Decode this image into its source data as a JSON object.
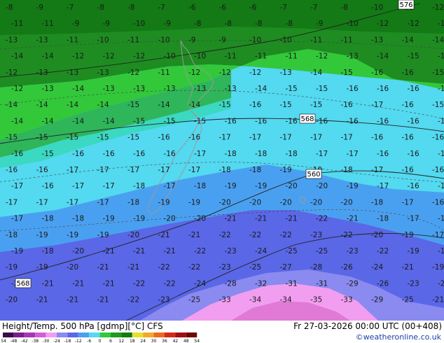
{
  "title": "Height/Temp. 500 hPa [gdmp][°C] CFS",
  "datetime": "Fr 27-03-2026 00:00 UTC (00+408)",
  "credit": "©weatheronline.co.uk",
  "height_contour_labels": [
    "576",
    "568",
    "560",
    "568"
  ],
  "colorbar": {
    "labels": [
      "-54",
      "-48",
      "-42",
      "-38",
      "-30",
      "-24",
      "-18",
      "-12",
      "-6",
      "0",
      "6",
      "12",
      "18",
      "24",
      "30",
      "36",
      "42",
      "48",
      "54"
    ],
    "colors": [
      "#3a0a4a",
      "#7a1f8a",
      "#a637b3",
      "#d05fd6",
      "#f29ef0",
      "#8a8af0",
      "#5a67e6",
      "#4aa0f0",
      "#53d9f0",
      "#32c83a",
      "#1e9a21",
      "#137a15",
      "#e8e02a",
      "#f0a82a",
      "#ec6a1c",
      "#d42a1a",
      "#a01010",
      "#6a0808"
    ]
  },
  "temperature_values": [
    [
      "-8",
      "-9",
      "-7",
      "-8",
      "-8",
      "-7",
      "-6",
      "-6",
      "-6",
      "-7",
      "-7",
      "-8",
      "-10",
      "-12",
      "-12"
    ],
    [
      "-11",
      "-11",
      "-9",
      "-9",
      "-10",
      "-9",
      "-8",
      "-8",
      "-8",
      "-8",
      "-9",
      "-10",
      "-12",
      "-12",
      "-13"
    ],
    [
      "-13",
      "-13",
      "-11",
      "-10",
      "-11",
      "-10",
      "-9",
      "-9",
      "-10",
      "-10",
      "-11",
      "-11",
      "-13",
      "-14",
      "-14"
    ],
    [
      "-14",
      "-14",
      "-12",
      "-12",
      "-12",
      "-10",
      "-10",
      "-11",
      "-11",
      "-11",
      "-12",
      "-13",
      "-14",
      "-15",
      "-16"
    ],
    [
      "-12",
      "-13",
      "-13",
      "-13",
      "-12",
      "-11",
      "-12",
      "-12",
      "-12",
      "-13",
      "-14",
      "-15",
      "-16",
      "-16",
      "-15"
    ],
    [
      "-12",
      "-13",
      "-14",
      "-13",
      "-13",
      "-13",
      "-13",
      "-13",
      "-14",
      "-15",
      "-15",
      "-16",
      "-16",
      "-16",
      "-16"
    ],
    [
      "-14",
      "-14",
      "-14",
      "-14",
      "-15",
      "-14",
      "-14",
      "-15",
      "-16",
      "-15",
      "-15",
      "-16",
      "-17",
      "-16",
      "-15"
    ],
    [
      "-14",
      "-14",
      "-14",
      "-14",
      "-15",
      "-15",
      "-15",
      "-16",
      "-16",
      "-16",
      "-16",
      "-16",
      "-16",
      "-16",
      "-16"
    ],
    [
      "-15",
      "-15",
      "-15",
      "-15",
      "-15",
      "-16",
      "-16",
      "-17",
      "-17",
      "-17",
      "-17",
      "-17",
      "-16",
      "-16",
      "-16"
    ],
    [
      "-16",
      "-15",
      "-16",
      "-16",
      "-16",
      "-16",
      "-17",
      "-18",
      "-18",
      "-18",
      "-17",
      "-17",
      "-16",
      "-16",
      "-17"
    ],
    [
      "-16",
      "-16",
      "-17",
      "-17",
      "-17",
      "-17",
      "-17",
      "-18",
      "-18",
      "-19",
      "-19",
      "-18",
      "-17",
      "-16",
      "-16"
    ],
    [
      "-17",
      "-16",
      "-17",
      "-17",
      "-18",
      "-17",
      "-18",
      "-19",
      "-19",
      "-20",
      "-20",
      "-19",
      "-17",
      "-16",
      "-15"
    ],
    [
      "-17",
      "-17",
      "-17",
      "-17",
      "-18",
      "-19",
      "-19",
      "-20",
      "-20",
      "-20",
      "-20",
      "-20",
      "-18",
      "-17",
      "-16"
    ],
    [
      "-17",
      "-18",
      "-18",
      "-19",
      "-19",
      "-20",
      "-20",
      "-21",
      "-21",
      "-21",
      "-22",
      "-21",
      "-18",
      "-17",
      "-16"
    ],
    [
      "-18",
      "-19",
      "-19",
      "-19",
      "-20",
      "-21",
      "-21",
      "-22",
      "-22",
      "-22",
      "-23",
      "-22",
      "-20",
      "-19",
      "-17"
    ],
    [
      "-19",
      "-18",
      "-20",
      "-21",
      "-21",
      "-21",
      "-22",
      "-23",
      "-24",
      "-25",
      "-25",
      "-23",
      "-22",
      "-19",
      "-18"
    ],
    [
      "-19",
      "-19",
      "-20",
      "-21",
      "-21",
      "-22",
      "-22",
      "-23",
      "-25",
      "-27",
      "-28",
      "-26",
      "-24",
      "-21",
      "-19"
    ],
    [
      "-20",
      "-21",
      "-21",
      "-21",
      "-22",
      "-22",
      "-24",
      "-28",
      "-32",
      "-31",
      "-31",
      "-29",
      "-26",
      "-23",
      "-21"
    ],
    [
      "-20",
      "-21",
      "-21",
      "-21",
      "-22",
      "-23",
      "-25",
      "-33",
      "-34",
      "-34",
      "-35",
      "-33",
      "-29",
      "-25",
      "-21"
    ]
  ]
}
